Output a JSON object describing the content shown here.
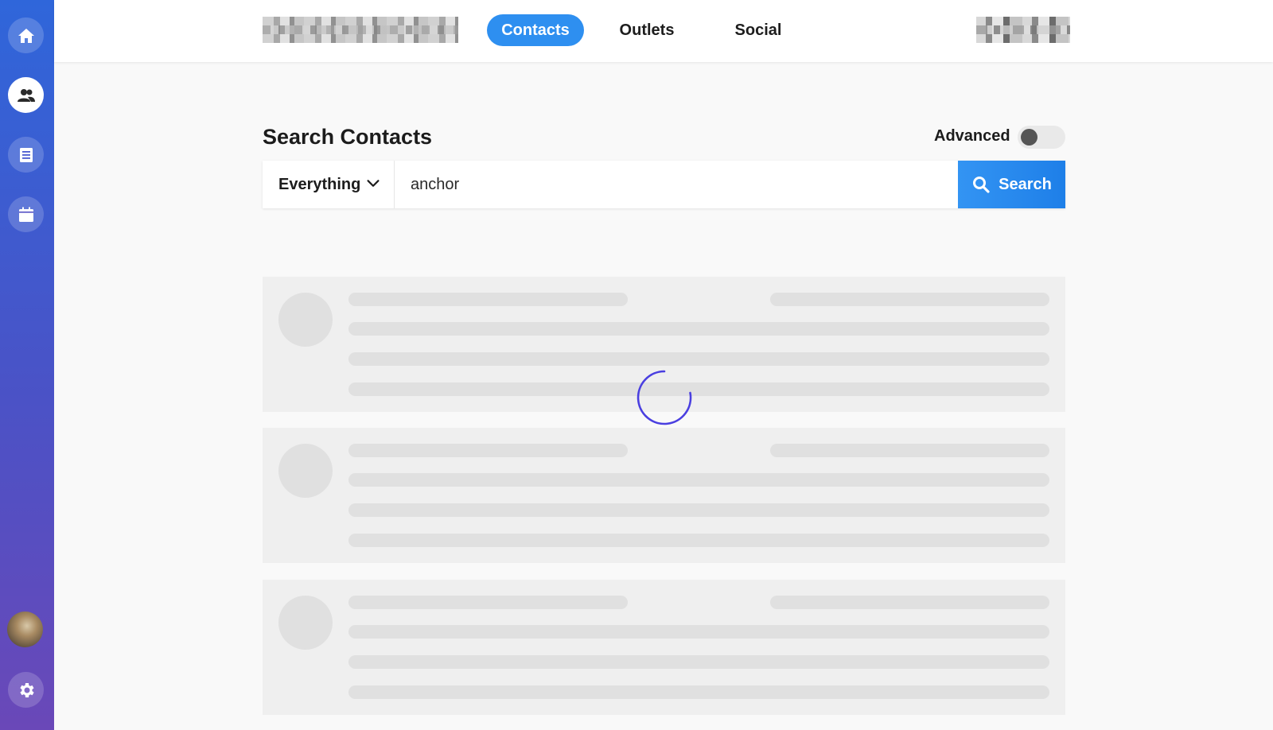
{
  "sidebar": {
    "items": [
      {
        "icon": "home-icon",
        "active": false
      },
      {
        "icon": "contacts-icon",
        "active": true
      },
      {
        "icon": "document-icon",
        "active": false
      },
      {
        "icon": "calendar-icon",
        "active": false
      }
    ],
    "bottom": [
      {
        "icon": "user-avatar"
      },
      {
        "icon": "gear-icon"
      }
    ]
  },
  "topbar": {
    "tabs": [
      {
        "label": "Contacts",
        "active": true
      },
      {
        "label": "Outlets",
        "active": false
      },
      {
        "label": "Social",
        "active": false
      }
    ]
  },
  "search": {
    "title": "Search Contacts",
    "advanced_label": "Advanced",
    "advanced_on": false,
    "scope": "Everything",
    "query": "anchor",
    "button_label": "Search"
  },
  "results": {
    "loading": true,
    "placeholder_cards": 3
  },
  "colors": {
    "accent": "#2e8ff0",
    "sidebar_top": "#2f66da",
    "sidebar_bottom": "#6a48b8",
    "spinner": "#4a3fe0"
  }
}
